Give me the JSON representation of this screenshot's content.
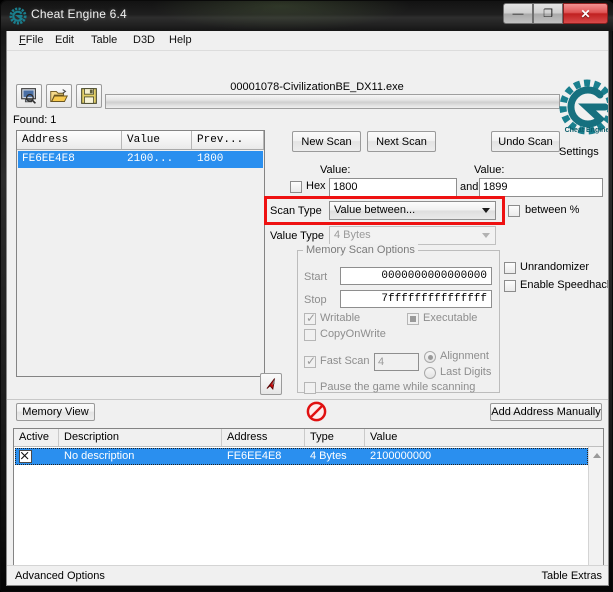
{
  "window": {
    "title": "Cheat Engine 6.4",
    "buttons": {
      "minimize": "—",
      "maximize": "❐",
      "close": "✕"
    }
  },
  "menubar": {
    "items": [
      {
        "label": "File",
        "accel": "F"
      },
      {
        "label": "Edit",
        "accel": "E"
      },
      {
        "label": "Table",
        "accel": "T"
      },
      {
        "label": "D3D",
        "accel": ""
      },
      {
        "label": "Help",
        "accel": "H"
      }
    ]
  },
  "toolbar": {
    "process_select": "process-select-icon",
    "open_file": "open-folder-icon",
    "save_file": "save-floppy-icon"
  },
  "process": {
    "title": "00001078-CivilizationBE_DX11.exe",
    "progress_percent": 0
  },
  "results": {
    "found_label": "Found: 1",
    "columns": [
      "Address",
      "Value",
      "Prev..."
    ],
    "rows": [
      {
        "address": "FE6EE4E8",
        "value": "2100...",
        "previous": "1800"
      }
    ]
  },
  "scan": {
    "new_scan": "New Scan",
    "next_scan": "Next Scan",
    "undo_scan": "Undo Scan",
    "settings_label": "Settings",
    "value_label_1": "Value:",
    "value_label_2": "Value:",
    "hex_label": "Hex",
    "hex_checked": false,
    "value_1": "1800",
    "and_label": "and",
    "value_2": "1899",
    "scan_type_label": "Scan Type",
    "scan_type_value": "Value between...",
    "between_percent_label": "between %",
    "between_percent_checked": false,
    "value_type_label": "Value Type",
    "value_type_value": "4 Bytes",
    "highlight_color": "#ee1111"
  },
  "memory_scan_options": {
    "group_title": "Memory Scan Options",
    "start_label": "Start",
    "start_value": "0000000000000000",
    "stop_label": "Stop",
    "stop_value": "7fffffffffffffff",
    "writable_label": "Writable",
    "writable_checked": true,
    "executable_label": "Executable",
    "executable_state": "grayed",
    "copyonwrite_label": "CopyOnWrite",
    "copyonwrite_checked": false,
    "fast_scan_label": "Fast Scan",
    "fast_scan_checked": true,
    "fast_scan_value": "4",
    "alignment_label": "Alignment",
    "last_digits_label": "Last Digits",
    "alignment_selected": true,
    "pause_label": "Pause the game while scanning",
    "pause_checked": false
  },
  "extras": {
    "unrandomizer_label": "Unrandomizer",
    "unrandomizer_checked": false,
    "speedhack_label": "Enable Speedhack",
    "speedhack_checked": false
  },
  "bottom_toolbar": {
    "memory_view": "Memory View",
    "add_address_manually": "Add Address Manually",
    "stop_icon": "stop-sign-icon",
    "pointer_icon": "red-arrow-pointer-icon"
  },
  "cheat_table": {
    "columns": [
      "Active",
      "Description",
      "Address",
      "Type",
      "Value"
    ],
    "rows": [
      {
        "active": true,
        "description": "No description",
        "address": "FE6EE4E8",
        "type": "4 Bytes",
        "value": "2100000000"
      }
    ]
  },
  "statusbar": {
    "left": "Advanced Options",
    "right": "Table Extras"
  }
}
